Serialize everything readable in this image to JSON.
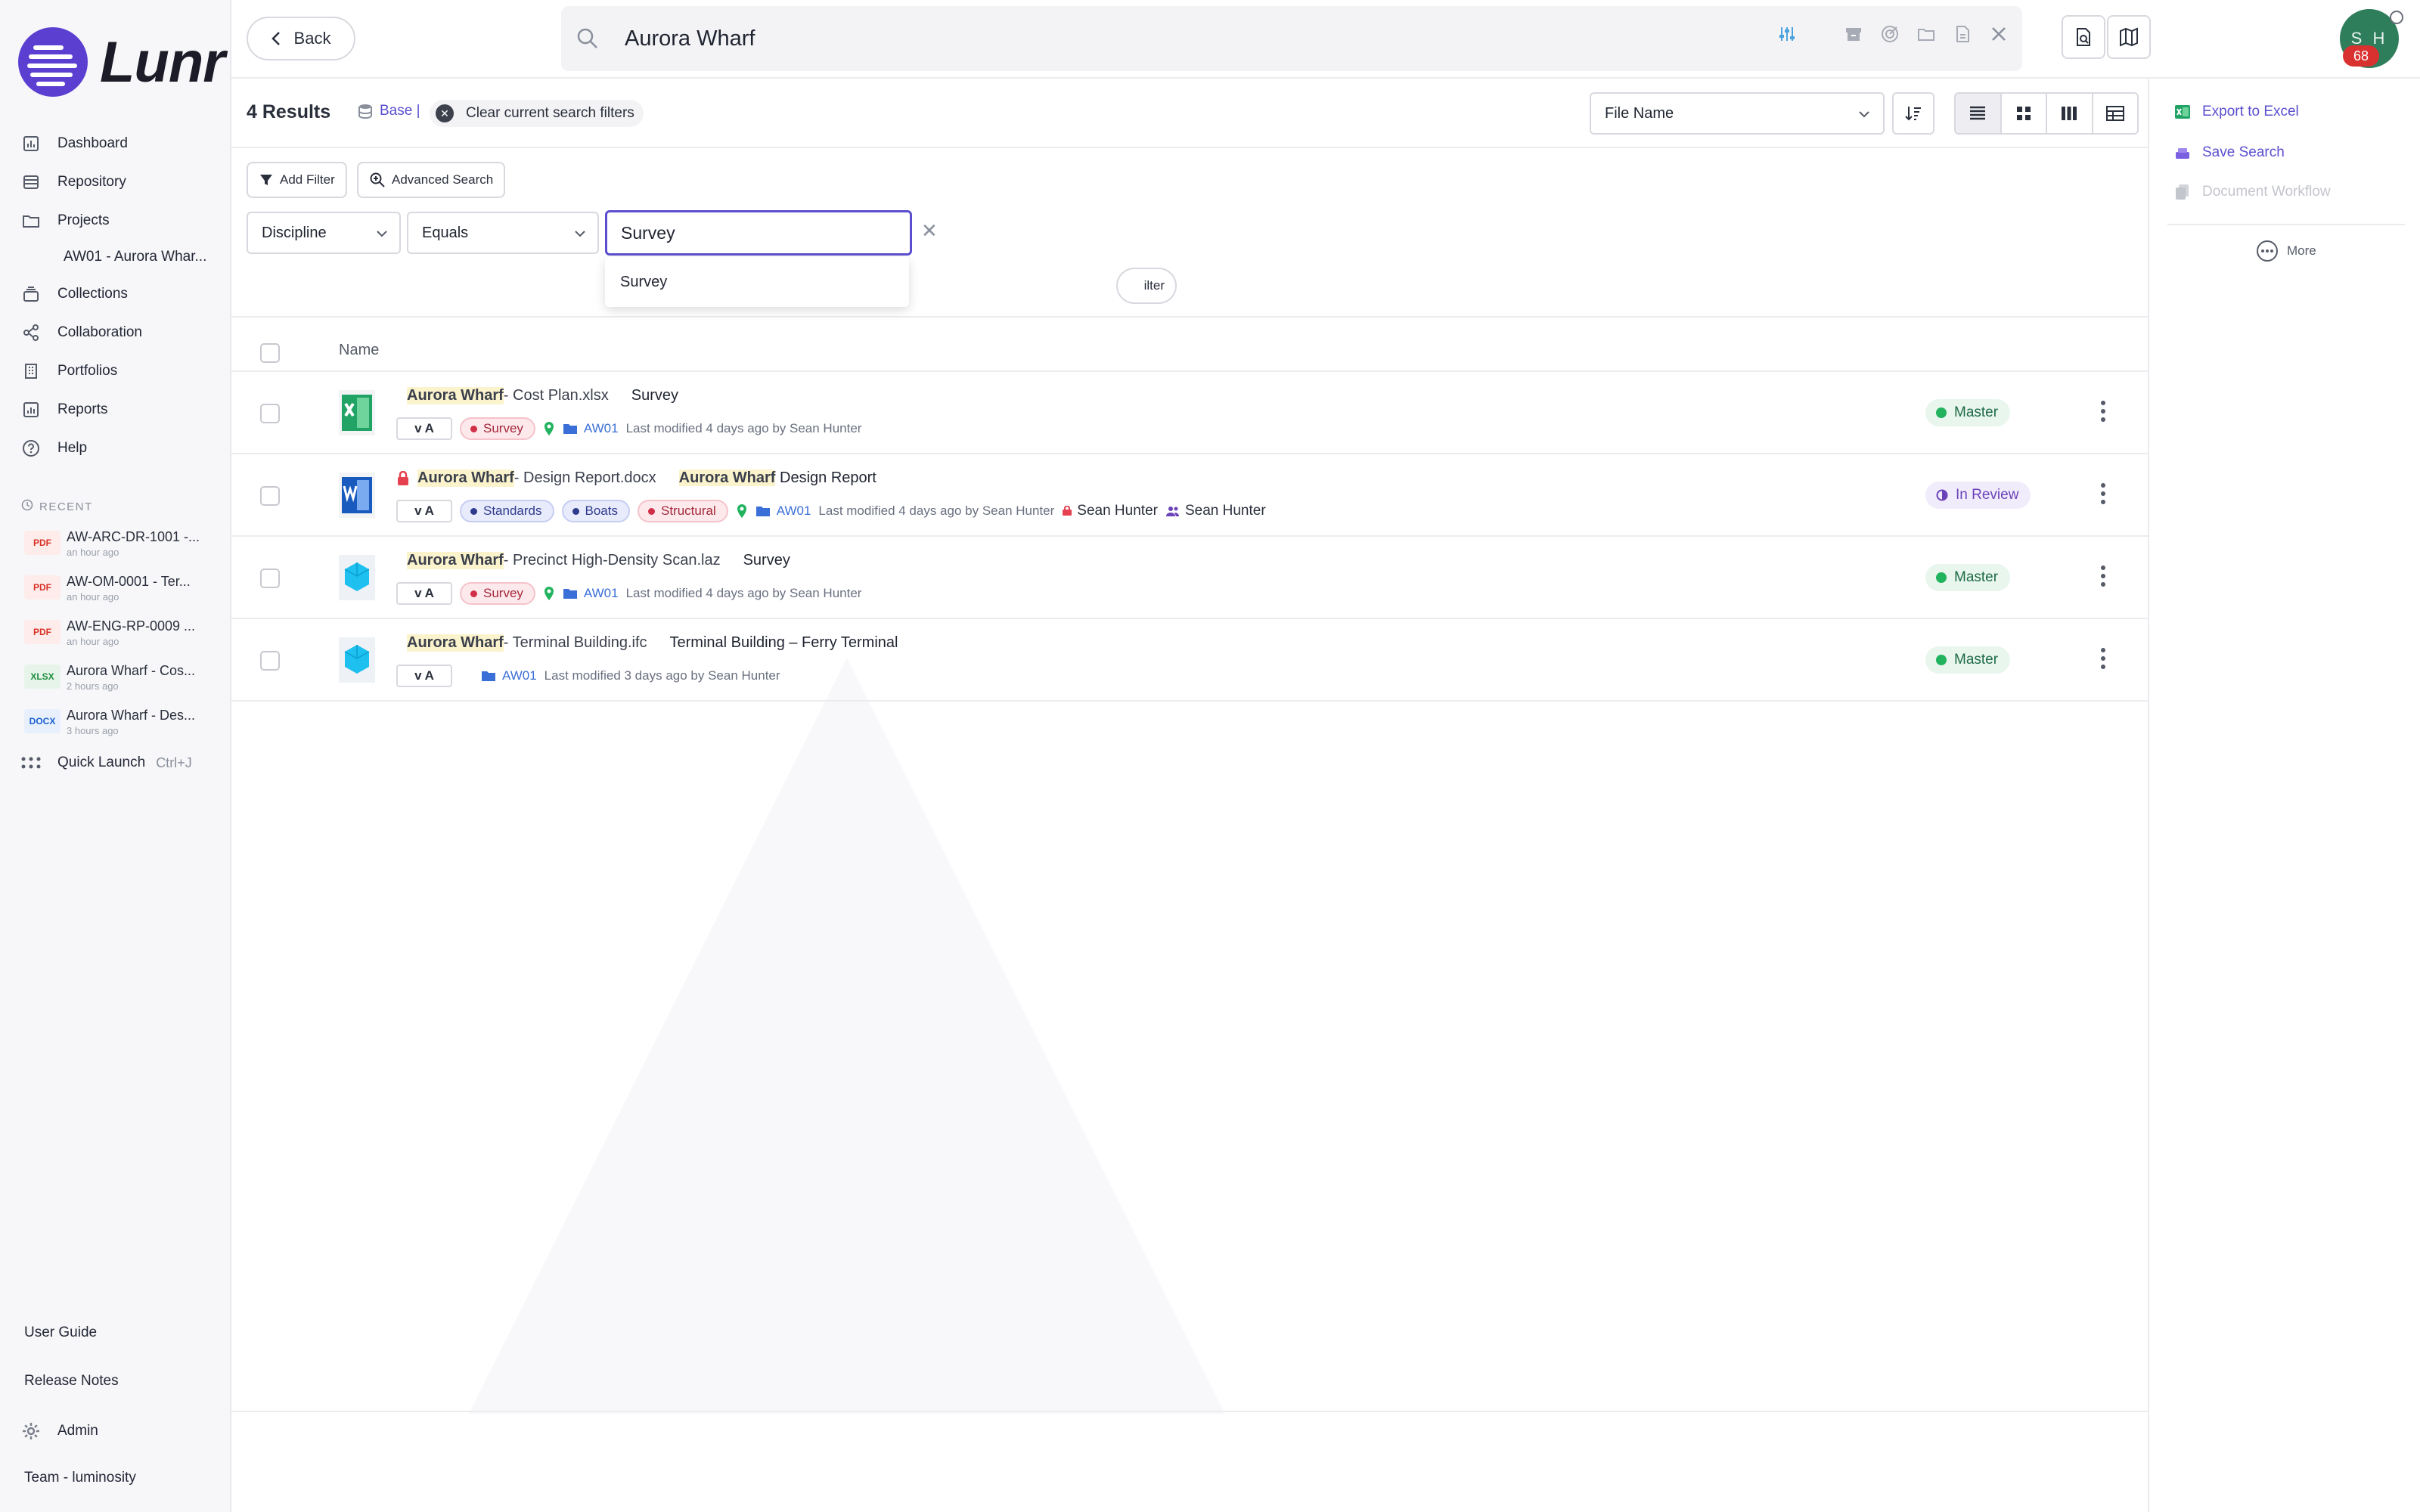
{
  "app": {
    "brand": "Lunr"
  },
  "sidebar": {
    "nav": [
      {
        "label": "Dashboard",
        "icon": "bar-chart-icon"
      },
      {
        "label": "Repository",
        "icon": "stack-icon"
      },
      {
        "label": "Projects",
        "icon": "folder-icon"
      }
    ],
    "project_sub": "AW01 - Aurora Whar...",
    "nav2": [
      {
        "label": "Collections",
        "icon": "collection-icon"
      },
      {
        "label": "Collaboration",
        "icon": "share-icon"
      },
      {
        "label": "Portfolios",
        "icon": "building-icon"
      },
      {
        "label": "Reports",
        "icon": "report-icon"
      },
      {
        "label": "Help",
        "icon": "help-icon"
      }
    ],
    "recent_label": "RECENT",
    "recent": [
      {
        "type": "PDF",
        "name": "AW-ARC-DR-1001 -...",
        "time": "an hour ago"
      },
      {
        "type": "PDF",
        "name": "AW-OM-0001 - Ter...",
        "time": "an hour ago"
      },
      {
        "type": "PDF",
        "name": "AW-ENG-RP-0009 ...",
        "time": "an hour ago"
      },
      {
        "type": "XLSX",
        "name": "Aurora Wharf - Cos...",
        "time": "2 hours ago"
      },
      {
        "type": "DOCX",
        "name": "Aurora Wharf - Des...",
        "time": "3 hours ago"
      }
    ],
    "quick_launch": "Quick Launch",
    "quick_launch_kbd": "Ctrl+J",
    "user_guide": "User Guide",
    "release_notes": "Release Notes",
    "admin": "Admin",
    "team": "Team - luminosity"
  },
  "topbar": {
    "back_label": "Back",
    "search_value": "Aurora Wharf",
    "avatar_initials": "S H",
    "avatar_count": "68"
  },
  "results": {
    "count_label": "4 Results",
    "base_label": "Base |",
    "clear_label": "Clear current search filters",
    "sort_value": "File Name"
  },
  "filters": {
    "add_filter": "Add Filter",
    "advanced_search": "Advanced Search",
    "field": "Discipline",
    "operator": "Equals",
    "value": "Survey",
    "dropdown_option": "Survey",
    "hidden_button_fragment": "ilter"
  },
  "table": {
    "name_header": "Name",
    "rows": [
      {
        "file_type": "xlsx",
        "locked": false,
        "title_hl": "Aurora Wharf",
        "title_rest": " - Cost Plan.xlsx",
        "desc_hl": "",
        "desc_rest": "Survey",
        "version": "v A",
        "tags": [
          {
            "label": "Survey",
            "color": "red"
          }
        ],
        "location": true,
        "folder": "AW01",
        "modified": "Last modified 4 days ago by Sean Hunter",
        "people": [],
        "status": "Master"
      },
      {
        "file_type": "docx",
        "locked": true,
        "title_hl": "Aurora Wharf",
        "title_rest": " - Design Report.docx",
        "desc_hl": "Aurora Wharf",
        "desc_rest": " Design Report",
        "version": "v A",
        "tags": [
          {
            "label": "Standards",
            "color": "blue"
          },
          {
            "label": "Boats",
            "color": "blue"
          },
          {
            "label": "Structural",
            "color": "red"
          }
        ],
        "location": true,
        "folder": "AW01",
        "modified": "Last modified 4 days ago by Sean Hunter",
        "people": [
          "Sean Hunter",
          "Sean Hunter"
        ],
        "status": "In Review"
      },
      {
        "file_type": "laz",
        "locked": false,
        "title_hl": "Aurora Wharf",
        "title_rest": " - Precinct High-Density Scan.laz",
        "desc_hl": "",
        "desc_rest": "Survey",
        "version": "v A",
        "tags": [
          {
            "label": "Survey",
            "color": "red"
          }
        ],
        "location": true,
        "folder": "AW01",
        "modified": "Last modified 4 days ago by Sean Hunter",
        "people": [],
        "status": "Master"
      },
      {
        "file_type": "ifc",
        "locked": false,
        "title_hl": "Aurora Wharf",
        "title_rest": " - Terminal Building.ifc",
        "desc_hl": "",
        "desc_rest": "Terminal Building – Ferry Terminal",
        "version": "v A",
        "tags": [],
        "location": false,
        "folder": "AW01",
        "modified": "Last modified 3 days ago by Sean Hunter",
        "people": [],
        "status": "Master"
      }
    ]
  },
  "right_panel": {
    "export_excel": "Export to Excel",
    "save_search": "Save Search",
    "document_workflow": "Document Workflow",
    "more": "More"
  },
  "colors": {
    "accent": "#5b4fcf",
    "master_green": "#22b35e",
    "survey_red": "#d12e47",
    "brand_purple": "#5b3fd1"
  }
}
